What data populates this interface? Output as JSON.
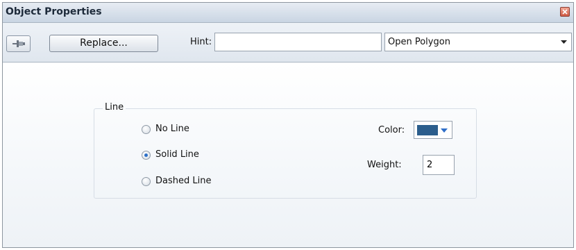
{
  "window": {
    "title": "Object Properties",
    "close_icon": "close-icon"
  },
  "toolbar": {
    "pin_icon": "pin-icon",
    "replace_label": "Replace...",
    "hint_label": "Hint:",
    "hint_value": "",
    "type_value": "Open Polygon"
  },
  "line_group": {
    "legend": "Line",
    "options": [
      {
        "label": "No Line",
        "selected": false
      },
      {
        "label": "Solid Line",
        "selected": true
      },
      {
        "label": "Dashed Line",
        "selected": false
      }
    ],
    "color_label": "Color:",
    "color_value": "#2b5d8c",
    "weight_label": "Weight:",
    "weight_value": "2"
  }
}
